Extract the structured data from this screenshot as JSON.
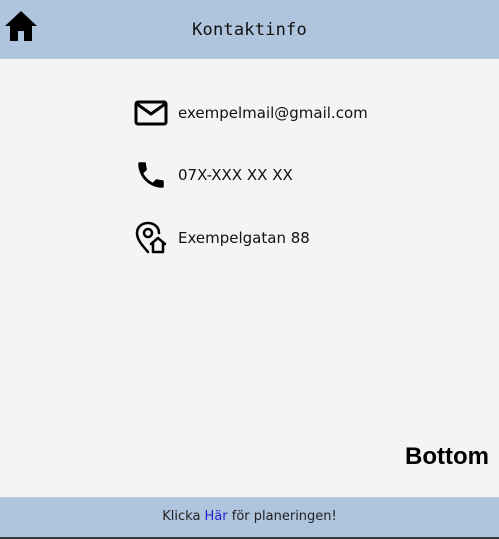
{
  "header": {
    "title": "Kontaktinfo",
    "home_icon": "home-icon",
    "background": "#afc4dd"
  },
  "contact": {
    "email": {
      "icon": "mail-icon",
      "text": "exempelmail@gmail.com"
    },
    "phone": {
      "icon": "phone-icon",
      "text": "07X-XXX XX XX"
    },
    "address": {
      "icon": "location-home-icon",
      "text": "Exempelgatan 88"
    }
  },
  "bottom_label": "Bottom",
  "footer": {
    "prefix": "Klicka ",
    "link_text": "Här",
    "suffix": " för planeringen!",
    "link_color": "#2222cc",
    "background": "#afc4dd"
  }
}
